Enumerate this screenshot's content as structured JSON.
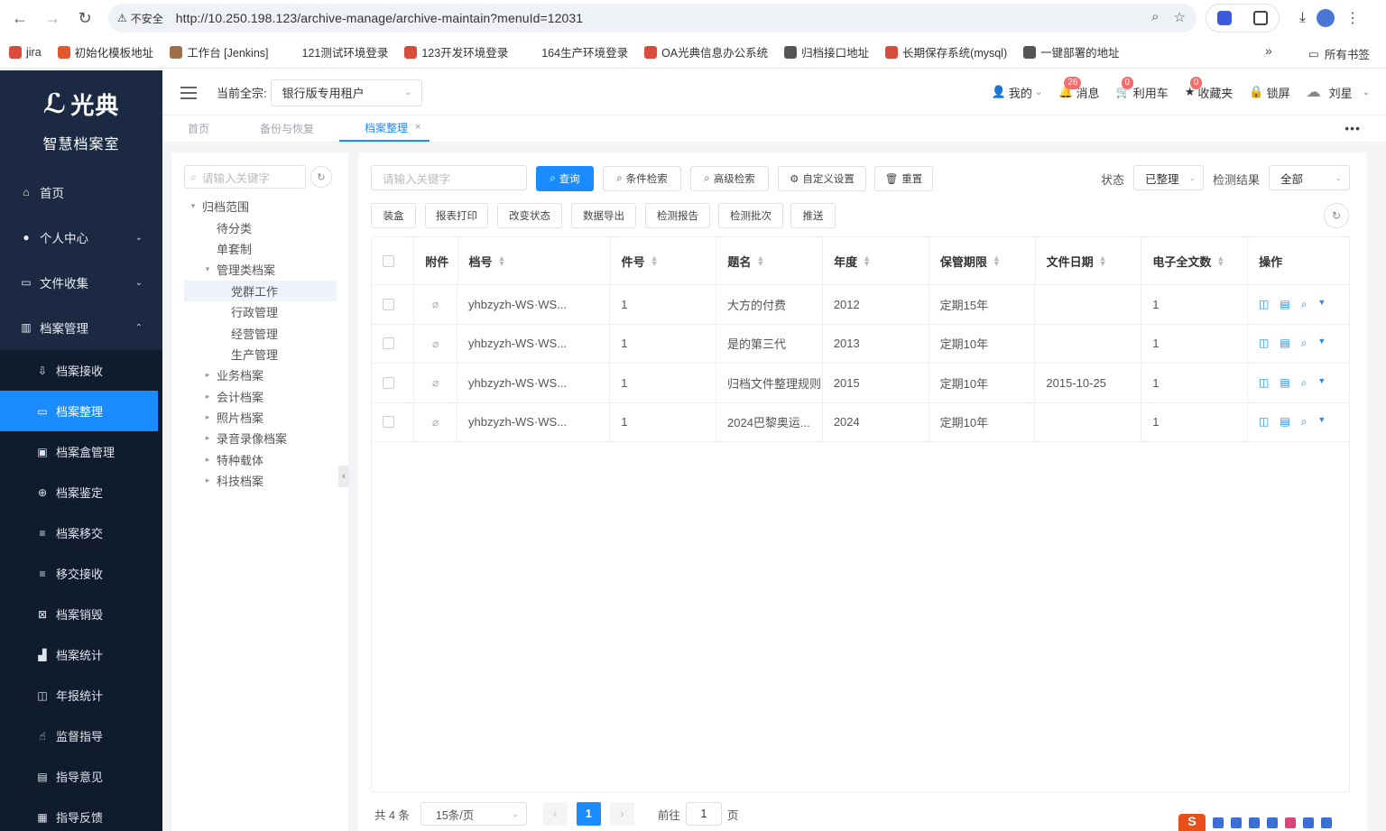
{
  "browser": {
    "security_label": "不安全",
    "url": "http://10.250.198.123/archive-manage/archive-maintain?menuId=12031",
    "bookmarks": [
      {
        "label": "jira",
        "color": "#d94b3b"
      },
      {
        "label": "初始化模板地址",
        "color": "#e2572b"
      },
      {
        "label": "工作台 [Jenkins]",
        "color": "#a0704a"
      },
      {
        "label": "121测试环境登录",
        "color": "#ffffff"
      },
      {
        "label": "123开发环境登录",
        "color": "#d94b3b"
      },
      {
        "label": "164生产环境登录",
        "color": "#ffffff"
      },
      {
        "label": "OA光典信息办公系统",
        "color": "#d94b3b"
      },
      {
        "label": "归档接口地址",
        "color": "#555555"
      },
      {
        "label": "长期保存系统(mysql)",
        "color": "#d94b3b"
      },
      {
        "label": "一键部署的地址",
        "color": "#555555"
      }
    ],
    "all_bookmarks": "所有书签"
  },
  "sidebar": {
    "brand": "光典",
    "subtitle": "智慧档案室",
    "items": [
      {
        "label": "首页",
        "icon": "home-icon",
        "glyph": "⌂"
      },
      {
        "label": "个人中心",
        "icon": "user-icon",
        "glyph": "●",
        "caret": "⌄"
      },
      {
        "label": "文件收集",
        "icon": "folder-icon",
        "glyph": "▭",
        "caret": "⌄"
      },
      {
        "label": "档案管理",
        "icon": "bank-icon",
        "glyph": "▥",
        "caret": "⌃"
      }
    ],
    "subitems": [
      {
        "label": "档案接收",
        "icon": "receive-icon",
        "glyph": "⇩"
      },
      {
        "label": "档案整理",
        "icon": "folder-open-icon",
        "glyph": "▭",
        "active": true
      },
      {
        "label": "档案盒管理",
        "icon": "box-icon",
        "glyph": "▣"
      },
      {
        "label": "档案鉴定",
        "icon": "target-icon",
        "glyph": "⊕"
      },
      {
        "label": "档案移交",
        "icon": "list-icon",
        "glyph": "≡"
      },
      {
        "label": "移交接收",
        "icon": "list-icon",
        "glyph": "≡"
      },
      {
        "label": "档案销毁",
        "icon": "destroy-icon",
        "glyph": "⊠"
      },
      {
        "label": "档案统计",
        "icon": "bar-chart-icon",
        "glyph": "▟"
      },
      {
        "label": "年报统计",
        "icon": "board-icon",
        "glyph": "◫"
      },
      {
        "label": "监督指导",
        "icon": "hand-icon",
        "glyph": "☝"
      },
      {
        "label": "指导意见",
        "icon": "comment-icon",
        "glyph": "▤"
      },
      {
        "label": "指导反馈",
        "icon": "feedback-icon",
        "glyph": "▦"
      }
    ]
  },
  "header": {
    "tenant_label": "当前全宗:",
    "tenant_value": "银行版专用租户",
    "mine": "我的",
    "messages": "消息",
    "messages_count": "26",
    "cart": "利用车",
    "cart_count": "0",
    "favorites": "收藏夹",
    "favorites_count": "0",
    "lock": "锁屏",
    "user": "刘星"
  },
  "tabs": [
    {
      "label": "首页"
    },
    {
      "label": "备份与恢复"
    },
    {
      "label": "档案整理",
      "active": true
    }
  ],
  "tree": {
    "placeholder": "请输入关键字",
    "nodes": [
      {
        "label": "归档范围",
        "level": 0,
        "arrow": "▾"
      },
      {
        "label": "待分类",
        "level": 1
      },
      {
        "label": "单套制",
        "level": 1
      },
      {
        "label": "管理类档案",
        "level": 1,
        "arrow": "▾"
      },
      {
        "label": "党群工作",
        "level": 2,
        "selected": true
      },
      {
        "label": "行政管理",
        "level": 2
      },
      {
        "label": "经营管理",
        "level": 2
      },
      {
        "label": "生产管理",
        "level": 2
      },
      {
        "label": "业务档案",
        "level": 1,
        "arrow": "▸"
      },
      {
        "label": "会计档案",
        "level": 1,
        "arrow": "▸"
      },
      {
        "label": "照片档案",
        "level": 1,
        "arrow": "▸"
      },
      {
        "label": "录音录像档案",
        "level": 1,
        "arrow": "▸"
      },
      {
        "label": "特种载体",
        "level": 1,
        "arrow": "▸"
      },
      {
        "label": "科技档案",
        "level": 1,
        "arrow": "▸"
      }
    ]
  },
  "toolbar": {
    "search_placeholder": "请输入关键字",
    "query": "查询",
    "condition_search": "条件检索",
    "advanced_search": "高级检索",
    "custom_settings": "自定义设置",
    "reset": "重置",
    "status_label": "状态",
    "status_value": "已整理",
    "check_label": "检测结果",
    "check_value": "全部",
    "actions": [
      "装盒",
      "报表打印",
      "改变状态",
      "数据导出",
      "检测报告",
      "检测批次",
      "推送"
    ]
  },
  "table": {
    "headers": [
      "附件",
      "档号",
      "件号",
      "题名",
      "年度",
      "保管期限",
      "文件日期",
      "电子全文数",
      "操作"
    ],
    "rows": [
      {
        "code": "yhbzyzh-WS·WS...",
        "num": "1",
        "title": "大方的付费",
        "year": "2012",
        "period": "定期15年",
        "date": "",
        "count": "1"
      },
      {
        "code": "yhbzyzh-WS·WS...",
        "num": "1",
        "title": "是的第三代",
        "year": "2013",
        "period": "定期10年",
        "date": "",
        "count": "1"
      },
      {
        "code": "yhbzyzh-WS·WS...",
        "num": "1",
        "title": "归档文件整理规则",
        "year": "2015",
        "period": "定期10年",
        "date": "2015-10-25",
        "count": "1"
      },
      {
        "code": "yhbzyzh-WS·WS...",
        "num": "1",
        "title": "2024巴黎奥运...",
        "year": "2024",
        "period": "定期10年",
        "date": "",
        "count": "1"
      }
    ]
  },
  "pager": {
    "total": "共 4 条",
    "page_size": "15条/页",
    "current": "1",
    "goto_label": "前往",
    "goto_value": "1",
    "page_suffix": "页"
  }
}
